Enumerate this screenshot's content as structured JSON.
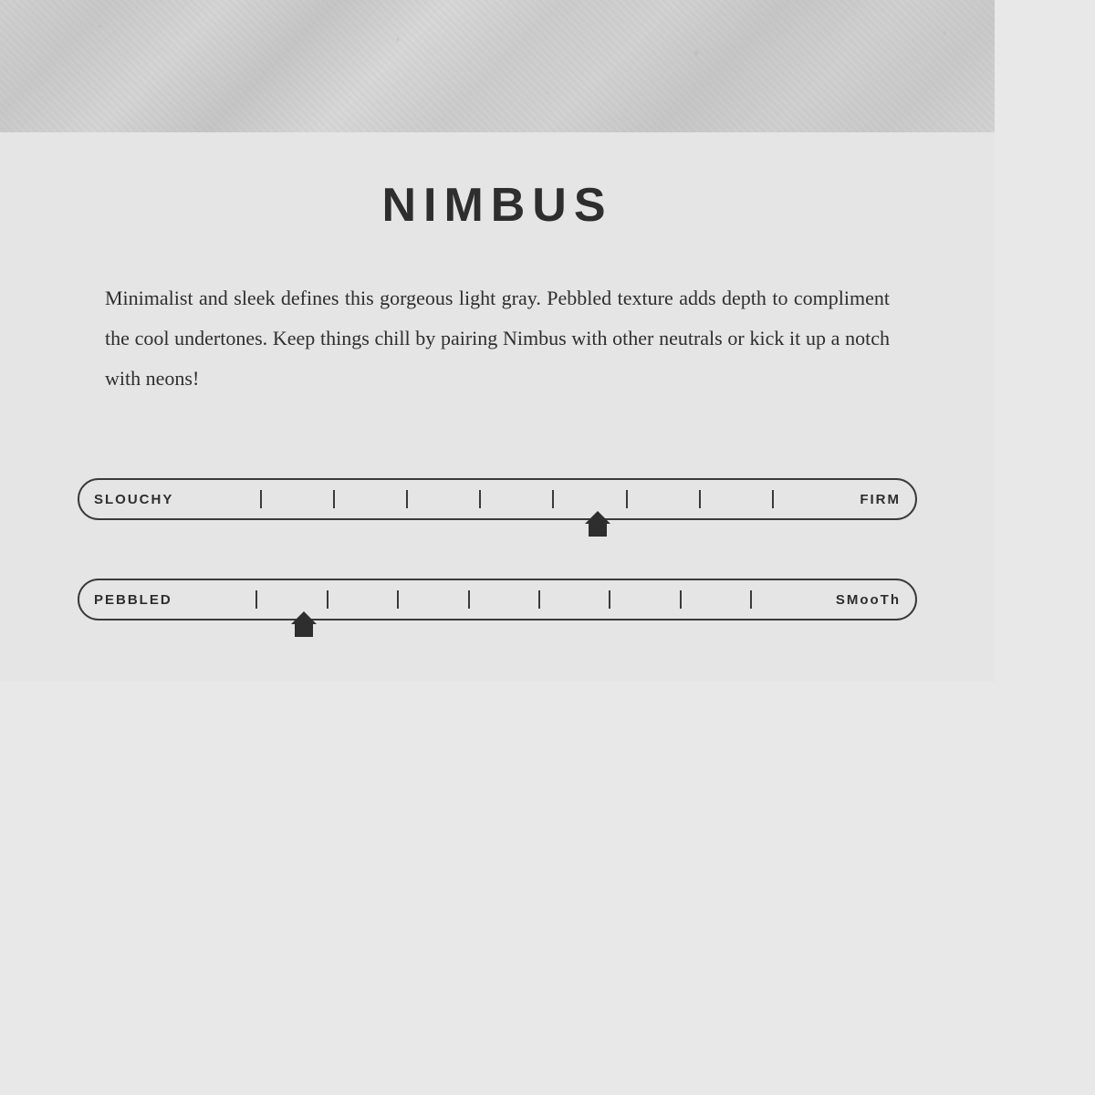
{
  "header": {
    "texture_alt": "leather texture header"
  },
  "product": {
    "title": "NIMBUS",
    "description": "Minimalist and sleek defines this gorgeous light gray. Pebbled texture adds depth to compliment the cool undertones. Keep things chill by pairing Nimbus with other neutrals or kick it up a notch with neons!"
  },
  "sliders": [
    {
      "id": "firmness",
      "label_left": "SLOUCHY",
      "label_right": "FIRM",
      "ticks": 8,
      "handle_position_percent": 62
    },
    {
      "id": "texture",
      "label_left": "PEBBLED",
      "label_right": "SMooTh",
      "ticks": 8,
      "handle_position_percent": 22
    }
  ],
  "colors": {
    "background": "#e5e5e5",
    "text_dark": "#2e2e2e",
    "border": "#3a3a3a"
  }
}
